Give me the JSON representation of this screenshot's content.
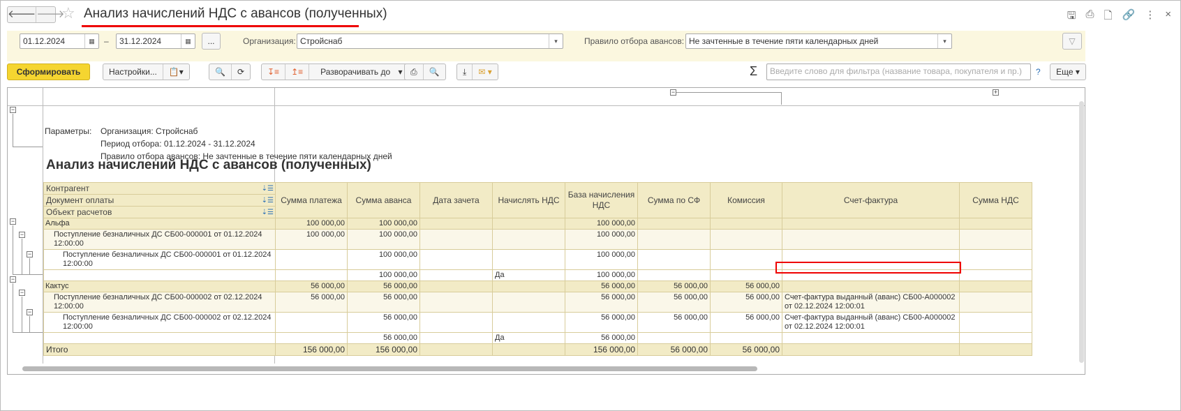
{
  "window": {
    "title": "Анализ начислений НДС с авансов (полученных)"
  },
  "filters": {
    "date_from": "01.12.2024",
    "date_to": "31.12.2024",
    "dash": "–",
    "period_button": "...",
    "org_label": "Организация:",
    "org_value": "Стройснаб",
    "rule_label": "Правило отбора авансов:",
    "rule_value": "Не зачтенные в течение пяти календарных дней"
  },
  "toolbar": {
    "generate": "Сформировать",
    "settings": "Настройки...",
    "expand_to": "Разворачивать до",
    "search_placeholder": "Введите слово для фильтра (название товара, покупателя и пр.)",
    "help": "?",
    "more": "Еще",
    "sigma": "Σ"
  },
  "report": {
    "params": [
      {
        "k": "Параметры:",
        "v": "Организация: Стройснаб"
      },
      {
        "k": "",
        "v": "Период отбора: 01.12.2024 - 31.12.2024"
      },
      {
        "k": "",
        "v": "Правило отбора авансов: Не зачтенные в течение пяти календарных дней"
      }
    ],
    "title": "Анализ начислений НДС с авансов (полученных)",
    "group_headers": [
      "Контрагент",
      "Документ оплаты",
      "Объект расчетов"
    ],
    "columns": [
      "Сумма платежа",
      "Сумма аванса",
      "Дата зачета",
      "Начислять НДС",
      "База начисления НДС",
      "Сумма по СФ",
      "Комиссия",
      "Счет-фактура",
      "Сумма НДС"
    ],
    "rows": [
      {
        "level": 1,
        "name": "Альфа",
        "cells": [
          "100 000,00",
          "100 000,00",
          "",
          "",
          "100 000,00",
          "",
          "",
          "",
          ""
        ]
      },
      {
        "level": 2,
        "name": "Поступление безналичных ДС СБ00-000001 от 01.12.2024 12:00:00",
        "cells": [
          "100 000,00",
          "100 000,00",
          "",
          "",
          "100 000,00",
          "",
          "",
          "",
          ""
        ]
      },
      {
        "level": 3,
        "name": "Поступление безналичных ДС СБ00-000001 от 01.12.2024 12:00:00",
        "cells": [
          "",
          "100 000,00",
          "",
          "",
          "100 000,00",
          "",
          "",
          "",
          ""
        ]
      },
      {
        "level": 4,
        "name": "",
        "cells": [
          "",
          "100 000,00",
          "",
          "Да",
          "100 000,00",
          "",
          "",
          "",
          ""
        ]
      },
      {
        "level": 1,
        "name": "Кактус",
        "cells": [
          "56 000,00",
          "56 000,00",
          "",
          "",
          "56 000,00",
          "56 000,00",
          "56 000,00",
          "",
          ""
        ]
      },
      {
        "level": 2,
        "name": "Поступление безналичных ДС СБ00-000002 от 02.12.2024 12:00:00",
        "cells": [
          "56 000,00",
          "56 000,00",
          "",
          "",
          "56 000,00",
          "56 000,00",
          "56 000,00",
          "Счет-фактура выданный (аванс) СБ00-А000002 от 02.12.2024 12:00:01",
          ""
        ]
      },
      {
        "level": 3,
        "name": "Поступление безналичных ДС СБ00-000002 от 02.12.2024 12:00:00",
        "cells": [
          "",
          "56 000,00",
          "",
          "",
          "56 000,00",
          "56 000,00",
          "56 000,00",
          "Счет-фактура выданный (аванс) СБ00-А000002 от 02.12.2024 12:00:01",
          ""
        ]
      },
      {
        "level": 4,
        "name": "",
        "cells": [
          "",
          "56 000,00",
          "",
          "Да",
          "56 000,00",
          "",
          "",
          "",
          ""
        ]
      }
    ],
    "total": {
      "name": "Итого",
      "cells": [
        "156 000,00",
        "156 000,00",
        "",
        "",
        "156 000,00",
        "56 000,00",
        "56 000,00",
        "",
        ""
      ]
    }
  }
}
